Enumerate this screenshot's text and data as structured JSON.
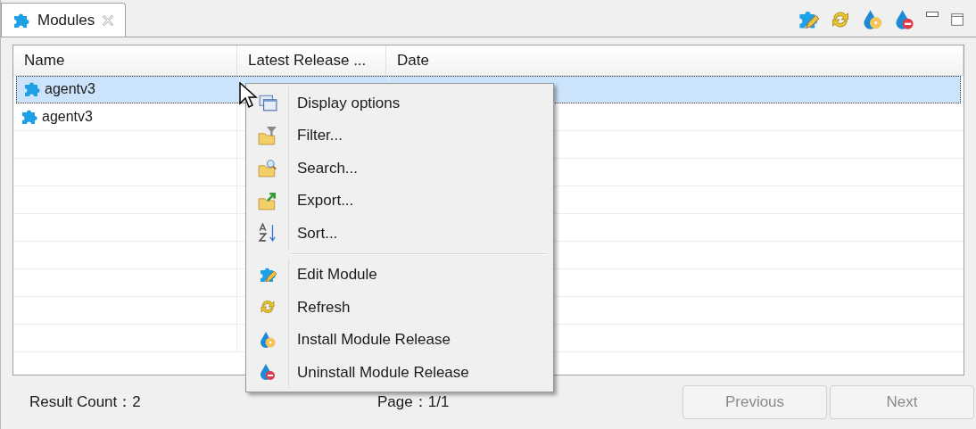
{
  "tab": {
    "title": "Modules",
    "selected": true
  },
  "table": {
    "columns": [
      "Name",
      "Latest Release ...",
      "Date"
    ],
    "rows": [
      {
        "name": "agentv3",
        "selected": true
      },
      {
        "name": "agentv3",
        "selected": false
      }
    ]
  },
  "context_menu": {
    "sections": [
      {
        "items": [
          "Display options",
          "Filter...",
          "Search...",
          "Export...",
          "Sort..."
        ]
      },
      {
        "items": [
          "Edit Module",
          "Refresh",
          "Install Module Release",
          "Uninstall Module Release"
        ]
      }
    ]
  },
  "footer": {
    "result_count": "Result Count：2",
    "page": "Page：1/1",
    "buttons": [
      {
        "label": "Previous",
        "disabled": true
      },
      {
        "label": "Next",
        "disabled": true
      }
    ]
  }
}
